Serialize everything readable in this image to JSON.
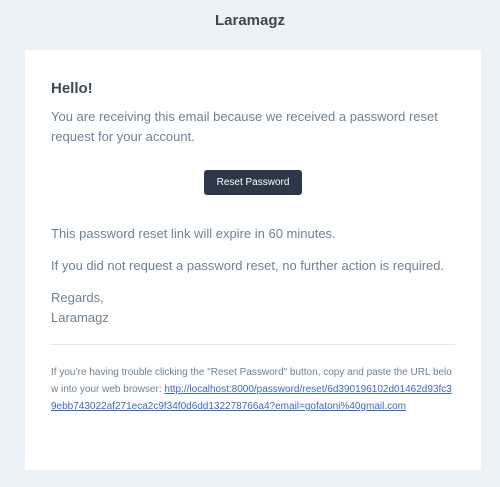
{
  "header": {
    "title": "Laramagz"
  },
  "email": {
    "greeting": "Hello!",
    "intro": "You are receiving this email because we received a password reset request for your account.",
    "button_label": "Reset Password",
    "expire_notice": "This password reset link will expire in 60 minutes.",
    "ignore_notice": "If you did not request a password reset, no further action is required.",
    "regards_line": "Regards,",
    "signature": "Laramagz",
    "subcopy_text": "If you’re having trouble clicking the \"Reset Password\" button, copy and paste the URL below into your web browser: ",
    "reset_url": "http://localhost:8000/password/reset/6d390196102d01462d93fc39ebb743022af271eca2c9f34f0d6dd132278766a4?email=gofatoni%40gmail.com"
  },
  "colors": {
    "background": "#edf2f7",
    "card": "#ffffff",
    "heading": "#3d4852",
    "body_text": "#718096",
    "button": "#2d3748",
    "link": "#3869d4"
  }
}
